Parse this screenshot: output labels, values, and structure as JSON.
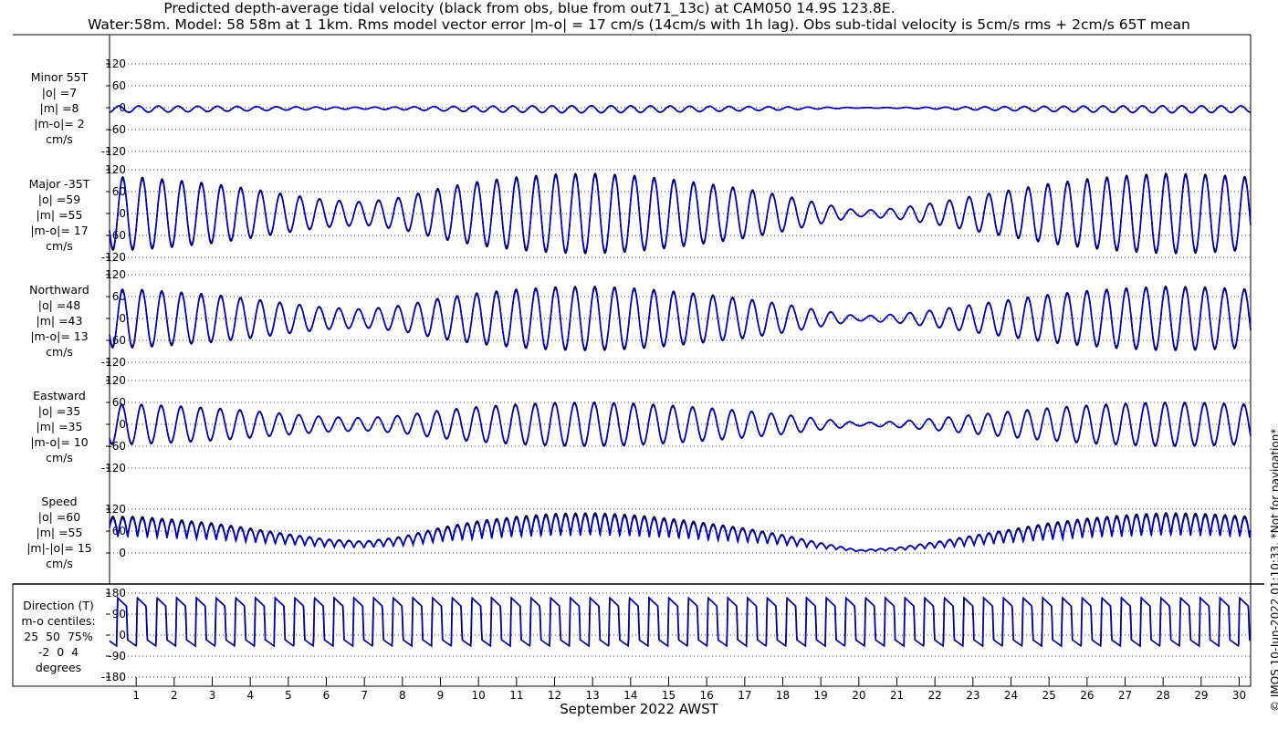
{
  "title_line1": "Predicted depth-average tidal velocity (black from obs, blue from out71_13c) at CAM050 14.9S 123.8E.",
  "title_line2": "Water:58m. Model: 58 58m at 1 1km. Rms model vector error |m-o| = 17 cm/s (14cm/s with 1h lag). Obs sub-tidal velocity is 5cm/s rms + 2cm/s 65T mean",
  "xlabel": "September 2022 AWST",
  "credit": "© IMOS 10-Jun-2022 01:10:33. *Not for navigation*",
  "colors": {
    "obs": "#000000",
    "model": "#0000cc",
    "grid": "#000000"
  },
  "panels": [
    {
      "label": "Minor 55T\n|o| =7\n|m| =8\n|m-o|= 2\ncm/s",
      "yticks": [
        "120",
        "60",
        "0",
        "-60",
        "-120"
      ]
    },
    {
      "label": "Major -35T\n|o| =59\n|m| =55\n|m-o|= 17\ncm/s",
      "yticks": [
        "120",
        "60",
        "0",
        "-60",
        "-120"
      ]
    },
    {
      "label": "Northward\n|o| =48\n|m| =43\n|m-o|= 13\ncm/s",
      "yticks": [
        "120",
        "60",
        "0",
        "-60",
        "-120"
      ]
    },
    {
      "label": "Eastward\n|o| =35\n|m| =35\n|m-o|= 10\ncm/s",
      "yticks": [
        "120",
        "60",
        "0",
        "-60",
        "-120"
      ]
    },
    {
      "label": "Speed\n|o| =60\n|m| =55\n|m|-|o|= 15\ncm/s",
      "yticks": [
        "120",
        "60",
        "0"
      ]
    },
    {
      "label": "Direction (T)\nm-o centiles:\n25  50  75%\n-2  0  4\ndegrees",
      "yticks": [
        "180",
        "90",
        "0",
        "-90",
        "-180"
      ]
    }
  ],
  "chart_data": {
    "type": "line",
    "x_unit": "day of September 2022 (AWST)",
    "xlim": [
      0.3,
      30.3
    ],
    "xticks": [
      "1",
      "2",
      "3",
      "4",
      "5",
      "6",
      "7",
      "8",
      "9",
      "10",
      "11",
      "12",
      "13",
      "14",
      "15",
      "16",
      "17",
      "18",
      "19",
      "20",
      "21",
      "22",
      "23",
      "24",
      "25",
      "26",
      "27",
      "28",
      "29",
      "30"
    ],
    "envelope_days": [
      0.3,
      1,
      2,
      3,
      4,
      5,
      6,
      7,
      8,
      9,
      10,
      11,
      12,
      13,
      14,
      15,
      16,
      17,
      18,
      19,
      20,
      21,
      22,
      23,
      24,
      25,
      26,
      27,
      28,
      29,
      30,
      30.3
    ],
    "major_amplitude_cm_s": [
      100,
      100,
      92,
      82,
      68,
      52,
      38,
      32,
      45,
      70,
      88,
      100,
      108,
      110,
      105,
      95,
      82,
      68,
      50,
      28,
      8,
      15,
      30,
      48,
      65,
      82,
      95,
      104,
      110,
      108,
      102,
      100
    ],
    "series": [
      {
        "name": "obs",
        "panels": [
          "Minor 55T",
          "Major -35T",
          "Northward",
          "Eastward",
          "Speed",
          "Direction (T)"
        ]
      },
      {
        "name": "out71_13c",
        "panels": [
          "Minor 55T",
          "Major -35T",
          "Northward",
          "Eastward",
          "Speed",
          "Direction (T)"
        ]
      }
    ],
    "ylim": {
      "velocity": [
        -120,
        120
      ],
      "speed": [
        0,
        120
      ],
      "direction": [
        -180,
        180
      ]
    }
  }
}
